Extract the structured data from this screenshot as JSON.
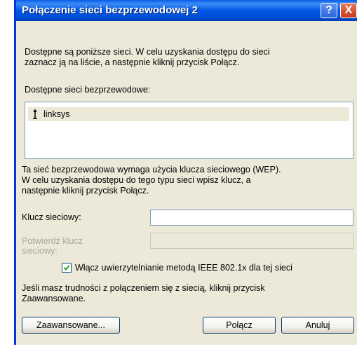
{
  "window": {
    "title": "Połączenie sieci bezprzewodowej 2",
    "help_glyph": "?",
    "close_glyph": "X"
  },
  "intro": {
    "line1": "Dostępne są poniższe sieci. W celu uzyskania dostępu do sieci",
    "line2": "zaznacz ją na liście, a następnie kliknij przycisk Połącz."
  },
  "networks": {
    "label": "Dostępne sieci bezprzewodowe:",
    "items": [
      {
        "name": "linksys",
        "icon": "signal-antenna-icon"
      }
    ]
  },
  "wep": {
    "line1": "Ta sieć bezprzewodowa wymaga użycia klucza sieciowego (WEP).",
    "line2": "W celu uzyskania dostępu do tego typu sieci wpisz klucz, a",
    "line3": "następnie kliknij przycisk Połącz."
  },
  "fields": {
    "network_key_label": "Klucz sieciowy:",
    "network_key_value": "",
    "confirm_key_label_line1": "Potwierdź klucz",
    "confirm_key_label_line2": "sieciowy:",
    "confirm_key_value": ""
  },
  "auth_checkbox": {
    "label": "Włącz uwierzytelnianie metodą IEEE 802.1x dla tej sieci",
    "checked": true
  },
  "help": {
    "line1": "Jeśli masz trudności z połączeniem się z siecią, kliknij przycisk",
    "line2": "Zaawansowane."
  },
  "buttons": {
    "advanced": "Zaawansowane...",
    "connect": "Połącz",
    "cancel": "Anuluj"
  },
  "colors": {
    "titlebar": "#0058e6",
    "dialog_bg": "#ece9d8",
    "disabled_text": "#aca899",
    "checkmark": "#21a121"
  }
}
